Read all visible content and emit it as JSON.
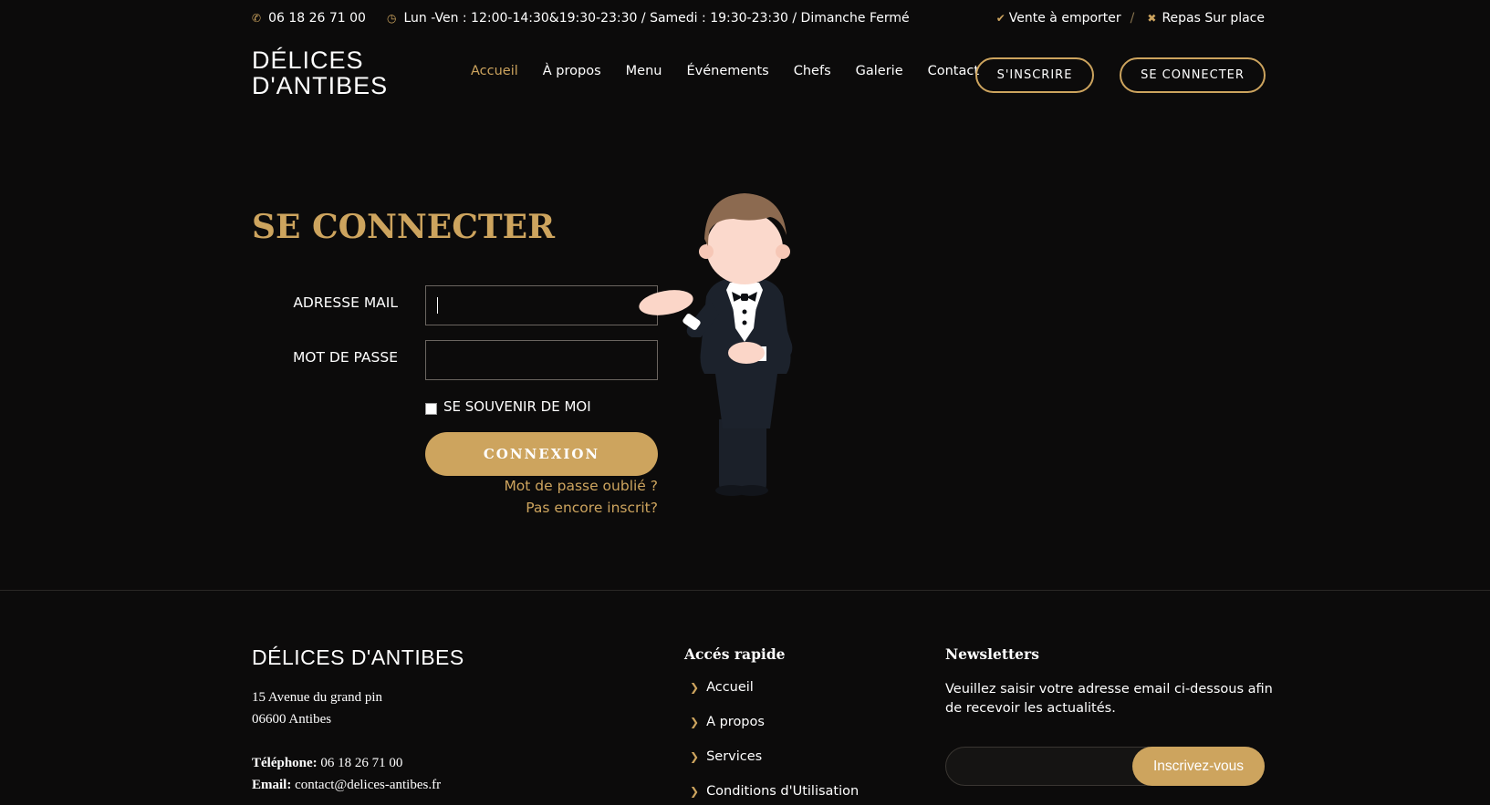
{
  "topbar": {
    "phone": "06 18 26 71 00",
    "hours": "Lun -Ven : 12:00-14:30&19:30-23:30 / Samedi : 19:30-23:30 / Dimanche Fermé",
    "takeaway": "Vente à emporter",
    "separator": "/",
    "dine_in": "Repas Sur place"
  },
  "header": {
    "logo_line1": "DÉLICES",
    "logo_line2": "D'ANTIBES",
    "nav": [
      "Accueil",
      "À propos",
      "Menu",
      "Événements",
      "Chefs",
      "Galerie",
      "Contact"
    ],
    "register_label": "S'INSCRIRE",
    "login_label": "SE CONNECTER"
  },
  "login": {
    "title": "SE CONNECTER",
    "email_label": "ADRESSE MAIL",
    "email_value": "",
    "password_label": "MOT DE PASSE",
    "password_value": "",
    "remember_label": "SE SOUVENIR DE MOI",
    "remember_checked": false,
    "submit_label": "CONNEXION",
    "forgot_link": "Mot de passe oublié ?",
    "register_link": "Pas encore inscrit?"
  },
  "footer": {
    "brand": "DÉLICES D'ANTIBES",
    "address_line1": "15 Avenue du grand pin",
    "address_line2": "06600 Antibes",
    "phone_label": "Téléphone:",
    "phone_value": "06 18 26 71 00",
    "email_label": "Email:",
    "email_value": "contact@delices-antibes.fr",
    "quick_heading": "Accés rapide",
    "quick_links": [
      "Accueil",
      "A propos",
      "Services",
      "Conditions d'Utilisation"
    ],
    "newsletter_heading": "Newsletters",
    "newsletter_text": "Veuillez saisir votre adresse email ci-dessous afin de recevoir les actualités.",
    "newsletter_button": "Inscrivez-vous"
  },
  "colors": {
    "background": "#0c0b0b",
    "accent": "#cda45e",
    "text": "#ffffff"
  }
}
